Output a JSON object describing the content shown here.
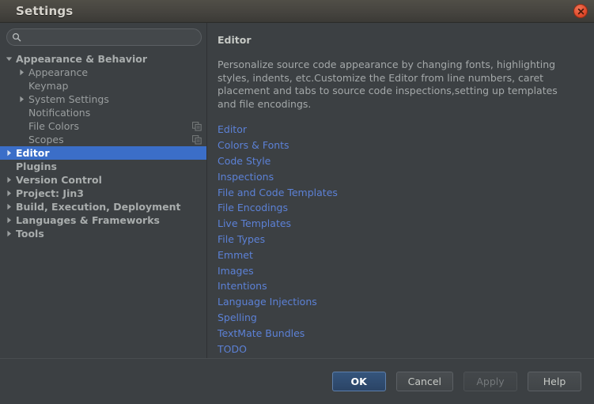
{
  "window": {
    "title": "Settings",
    "close_icon": "close-icon"
  },
  "sidebar": {
    "search": {
      "icon": "search-icon",
      "value": "",
      "placeholder": ""
    },
    "tree": [
      {
        "label": "Appearance & Behavior",
        "level": 0,
        "twisty": "expanded",
        "bold": true,
        "selected": false,
        "badge": null
      },
      {
        "label": "Appearance",
        "level": 1,
        "twisty": "collapsed",
        "bold": false,
        "selected": false,
        "badge": null
      },
      {
        "label": "Keymap",
        "level": 1,
        "twisty": "none",
        "bold": false,
        "selected": false,
        "badge": null
      },
      {
        "label": "System Settings",
        "level": 1,
        "twisty": "collapsed",
        "bold": false,
        "selected": false,
        "badge": null
      },
      {
        "label": "Notifications",
        "level": 1,
        "twisty": "none",
        "bold": false,
        "selected": false,
        "badge": null
      },
      {
        "label": "File Colors",
        "level": 1,
        "twisty": "none",
        "bold": false,
        "selected": false,
        "badge": "copy-icon"
      },
      {
        "label": "Scopes",
        "level": 1,
        "twisty": "none",
        "bold": false,
        "selected": false,
        "badge": "copy-icon"
      },
      {
        "label": "Editor",
        "level": 0,
        "twisty": "collapsed",
        "bold": true,
        "selected": true,
        "badge": null
      },
      {
        "label": "Plugins",
        "level": 0,
        "twisty": "none",
        "bold": true,
        "selected": false,
        "badge": null
      },
      {
        "label": "Version Control",
        "level": 0,
        "twisty": "collapsed",
        "bold": true,
        "selected": false,
        "badge": null
      },
      {
        "label": "Project: Jin3",
        "level": 0,
        "twisty": "collapsed",
        "bold": true,
        "selected": false,
        "badge": null
      },
      {
        "label": "Build, Execution, Deployment",
        "level": 0,
        "twisty": "collapsed",
        "bold": true,
        "selected": false,
        "badge": null
      },
      {
        "label": "Languages & Frameworks",
        "level": 0,
        "twisty": "collapsed",
        "bold": true,
        "selected": false,
        "badge": null
      },
      {
        "label": "Tools",
        "level": 0,
        "twisty": "collapsed",
        "bold": true,
        "selected": false,
        "badge": null
      }
    ]
  },
  "main": {
    "title": "Editor",
    "description": "Personalize source code appearance by changing fonts, highlighting styles, indents, etc.Customize the Editor from line numbers, caret placement and tabs to source code inspections,setting up templates and file encodings.",
    "links": [
      "Editor",
      "Colors & Fonts",
      "Code Style",
      "Inspections",
      "File and Code Templates",
      "File Encodings",
      "Live Templates",
      "File Types",
      "Emmet",
      "Images",
      "Intentions",
      "Language Injections",
      "Spelling",
      "TextMate Bundles",
      "TODO"
    ]
  },
  "footer": {
    "buttons": [
      {
        "label": "OK",
        "style": "default",
        "enabled": true
      },
      {
        "label": "Cancel",
        "style": "normal",
        "enabled": true
      },
      {
        "label": "Apply",
        "style": "disabled",
        "enabled": false
      },
      {
        "label": "Help",
        "style": "normal",
        "enabled": true
      }
    ]
  },
  "colors": {
    "selection_blue": "#3b6ec8",
    "link_blue": "#5c81d6",
    "panel_bg": "#3c4043",
    "titlebar_bg": "#46443f",
    "close_red": "#e14b2c",
    "text_grey": "#9a9e9f"
  }
}
